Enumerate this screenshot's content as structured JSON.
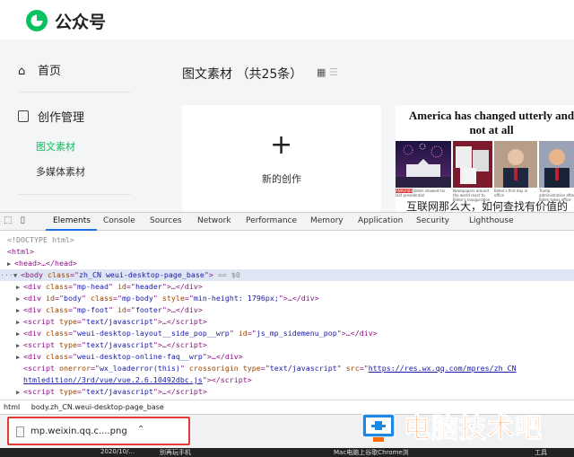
{
  "header": {
    "brand": "公众号"
  },
  "sidebar": {
    "home_label": "首页",
    "content_label": "创作管理",
    "sub_items": [
      "图文素材",
      "多媒体素材"
    ]
  },
  "main": {
    "title": "图文素材 （共25条）",
    "new_card_label": "新的创作",
    "article": {
      "headline": "America has changed utterly and not at all",
      "title": "互联网那么大，如何查找有价值的",
      "captions": [
        "Biden showed his last presidential",
        "Newspapers around the world react to Biden's inauguration",
        "Biden's first day in office",
        "Trump administration after Biden takes office"
      ],
      "highlight_color": "#e53935"
    }
  },
  "devtools": {
    "tabs": [
      "Elements",
      "Console",
      "Sources",
      "Network",
      "Performance",
      "Memory",
      "Application",
      "Security",
      "Lighthouse"
    ],
    "active_tab": "Elements",
    "accent_color": "#1a73e8",
    "lines": {
      "doctype": "<!DOCTYPE html>",
      "html_open": "<html>",
      "head": "<head>…</head>",
      "body_tag": "body",
      "body_attr": "class",
      "body_val": "zh_CN weui-desktop-page_base",
      "body_eq": "== $0",
      "l1_id": "mp-head",
      "l1_id2": "header",
      "l2_id": "body",
      "l2_class": "mp-body",
      "l2_style": "min-height: 1796px;",
      "l3_class": "mp-foot",
      "l3_id": "footer",
      "script_type": "text/javascript",
      "l5_class": "weui-desktop-layout__side_pop__wrp",
      "l5_id": "js_mp_sidemenu_pop",
      "l7_class": "weui-desktop-online-faq__wrp",
      "l8_onerror": "wx_loaderror(this)",
      "l8_src1": "https://res.wx.qq.com/mpres/zh_CN",
      "l8_src2": "htmledition//3rd/vue/vue.2.6.10492dbc.js"
    },
    "breadcrumb": [
      "html",
      "body.zh_CN.weui-desktop-page_base"
    ]
  },
  "download": {
    "filename": "mp.weixin.qq.c....png",
    "highlight_color": "#e53935"
  },
  "watermark": {
    "text": "电脑技术吧",
    "color": "#ff6a00"
  },
  "taskbar": {
    "items": [
      "2020/10/...",
      "别再玩手机",
      "Mac电脑上谷歌Chrome浏",
      "工具"
    ]
  }
}
